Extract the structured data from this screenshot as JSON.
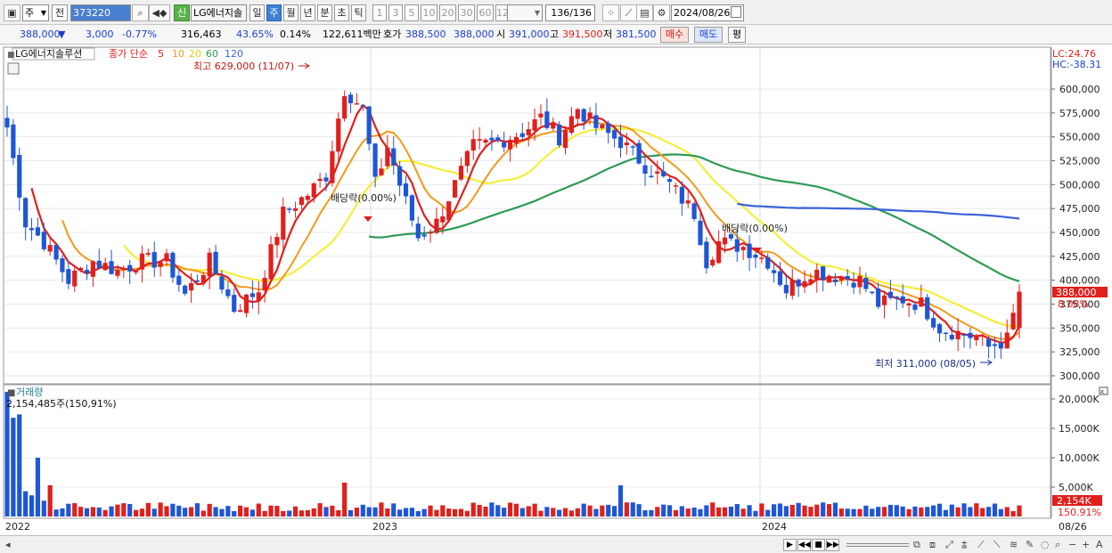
{
  "toolbar": {
    "period_menu": "주",
    "prev_label": "전",
    "code": "373220",
    "badge": "신",
    "stock_name": "LG에너지솔",
    "periods": [
      "일",
      "주",
      "월",
      "년",
      "분",
      "초",
      "틱"
    ],
    "selected_period": "주",
    "intervals": [
      "1",
      "3",
      "5",
      "10",
      "20",
      "30",
      "60",
      "120"
    ],
    "count": "136",
    "total": "/136",
    "date": "2024/08/26"
  },
  "info": {
    "price": "388,000",
    "change_arrow": "▼",
    "change": "3,000",
    "change_pct": "-0.77%",
    "volume": "316,463",
    "vol_ratio": "43.65%",
    "turnover": "0.14%",
    "amount": "122,611백만",
    "hoga_label": "호가",
    "hoga1": "388,500",
    "hoga2": "388,000",
    "open_label": "시",
    "open": "391,000",
    "high_label": "고",
    "high": "391,500",
    "low_label": "저",
    "low": "381,500",
    "buy_label": "매수",
    "sell_label": "매도",
    "eval_label": "평"
  },
  "chart": {
    "legend_name": "LG에너지솔루션",
    "legend_ma_label": "종가 단순",
    "legend_ma": [
      "5",
      "10",
      "20",
      "60",
      "120"
    ],
    "high_annotation": "최고 629,000 (11/07)",
    "low_annotation": "최저 311,000 (08/05)",
    "div_annotation_1": "배당락(0.00%)",
    "div_annotation_2": "배당락(0.00%)",
    "lc": "LC:24.76",
    "hc": "HC:-38.31",
    "price_ticks": [
      "600,000",
      "575,000",
      "550,000",
      "525,000",
      "500,000",
      "475,000",
      "450,000",
      "425,000",
      "400,000",
      "375,000",
      "350,000",
      "325,000",
      "300,000"
    ],
    "current_price_tag": "388,000",
    "current_pct_tag": "8.08%",
    "volume_title": "거래량",
    "volume_value": "2,154,485주(150,91%)",
    "volume_ticks": [
      "20,000K",
      "15,000K",
      "10,000K",
      "5,000K"
    ],
    "current_vol_tag": "2,154K",
    "current_vol_pct": "150.91%",
    "x_labels": [
      "2022",
      "2023",
      "2024",
      "08/26"
    ],
    "colors": {
      "up": "#e0201c",
      "down": "#1e56d6",
      "ma5": "#e0201c",
      "ma10": "#f29a1c",
      "ma20": "#f5ee3a",
      "ma60": "#2e9a56",
      "ma120": "#3a63d8"
    }
  },
  "chart_data": {
    "type": "candlestick",
    "period": "weekly",
    "x_labels": [
      "2022",
      "2023",
      "2024"
    ],
    "ylim": [
      300000,
      630000
    ],
    "series_summary": {
      "high": 629000,
      "high_date": "11/07",
      "low": 311000,
      "low_date": "08/05",
      "last": {
        "open": 391000,
        "high": 391500,
        "low": 381500,
        "close": 388000
      }
    },
    "moving_averages": [
      "5",
      "10",
      "20",
      "60",
      "120"
    ]
  }
}
